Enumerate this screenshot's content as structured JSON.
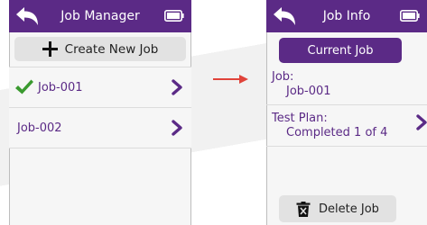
{
  "left_screen": {
    "title": "Job Manager",
    "create_button": "Create New Job",
    "jobs": [
      {
        "label": "Job-001",
        "checked": true
      },
      {
        "label": "Job-002",
        "checked": false
      }
    ]
  },
  "right_screen": {
    "title": "Job Info",
    "current_job_button": "Current Job",
    "job_label": "Job:",
    "job_value": "Job-001",
    "test_plan_label": "Test Plan:",
    "test_plan_value": "Completed 1 of 4",
    "delete_button": "Delete Job"
  },
  "colors": {
    "accent": "#5b2a86",
    "button_gray": "#e2e2e2",
    "check_green": "#3a9a2f",
    "arrow_red": "#e0433a"
  },
  "icons": [
    "back-arrow-icon",
    "battery-icon",
    "plus-icon",
    "checkmark-icon",
    "chevron-right-icon",
    "trash-icon",
    "transition-arrow-icon"
  ]
}
